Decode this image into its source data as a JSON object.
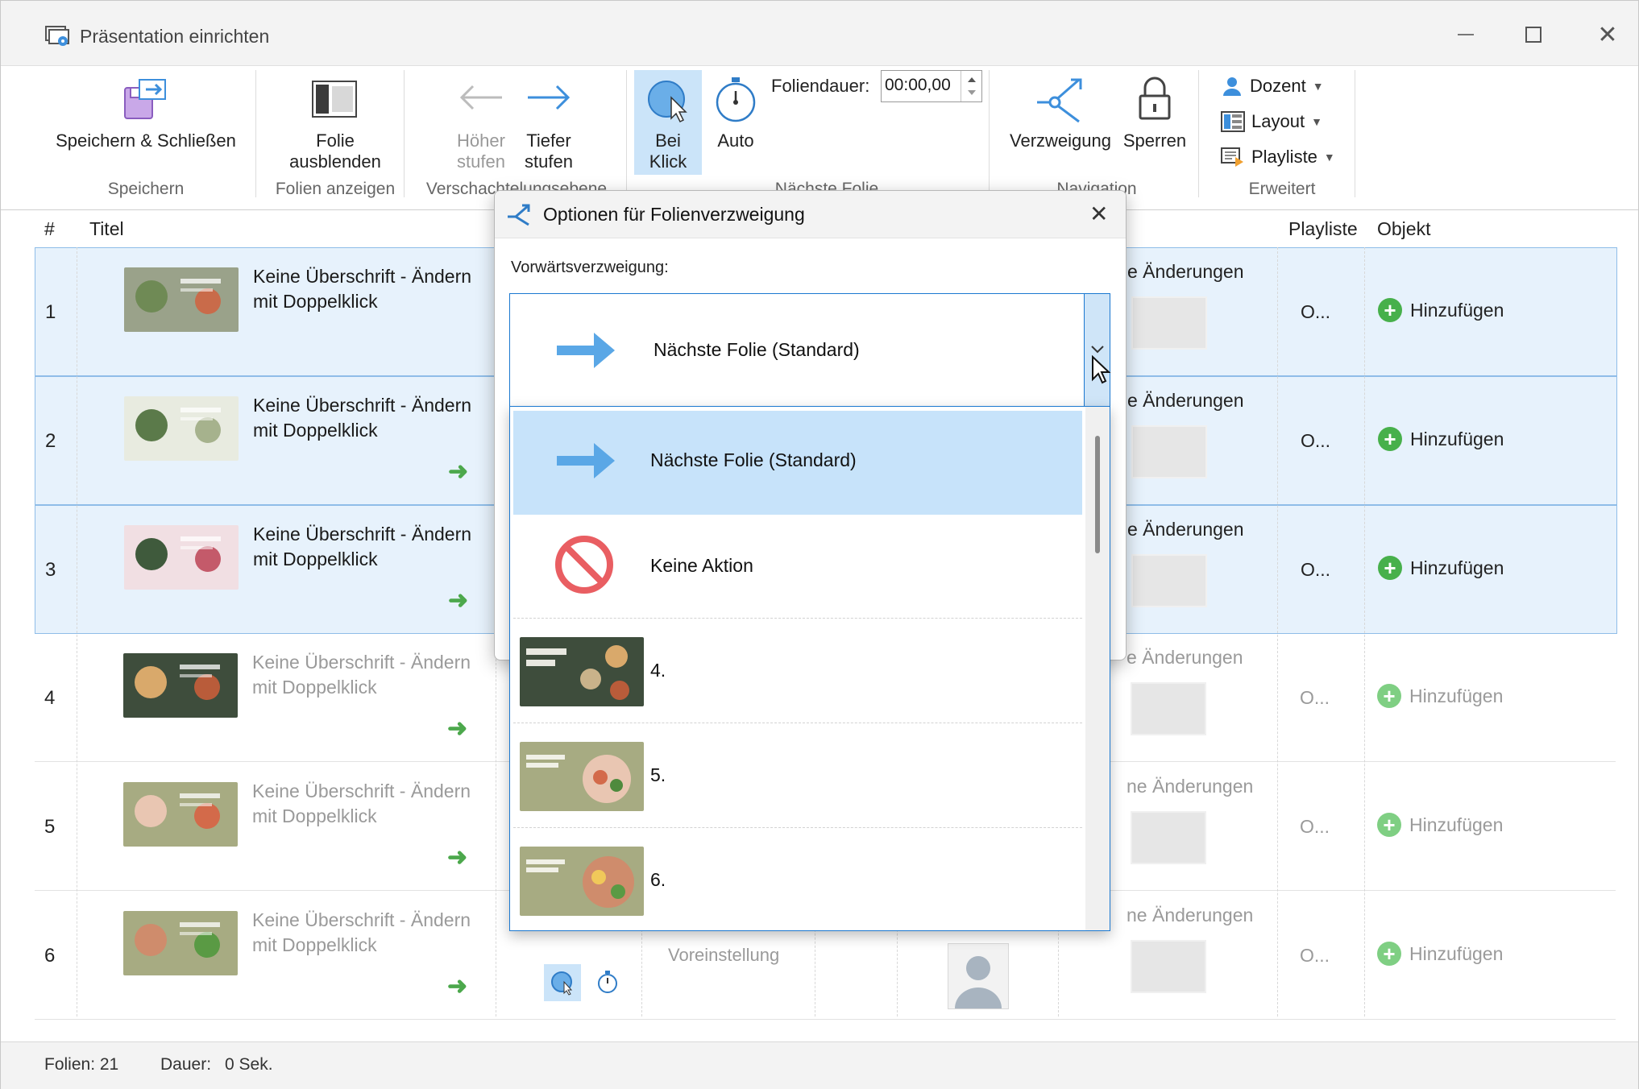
{
  "window": {
    "title": "Präsentation einrichten"
  },
  "ribbon": {
    "save_close_label": "Speichern & Schließen",
    "group_save": "Speichern",
    "hide_slide_label_1": "Folie",
    "hide_slide_label_2": "ausblenden",
    "group_show_slides": "Folien anzeigen",
    "promote_label_1": "Höher",
    "promote_label_2": "stufen",
    "demote_label_1": "Tiefer",
    "demote_label_2": "stufen",
    "group_nesting": "Verschachtelungsebene",
    "on_click_label_1": "Bei",
    "on_click_label_2": "Klick",
    "auto_label": "Auto",
    "slide_duration_label": "Foliendauer:",
    "slide_duration_value": "00:00,00",
    "group_next_slide": "Nächste Folie",
    "branching_label": "Verzweigung",
    "lock_label": "Sperren",
    "group_navigation": "Navigation",
    "presenter_label": "Dozent",
    "layout_label": "Layout",
    "playlist_label": "Playliste",
    "group_advanced": "Erweitert"
  },
  "table": {
    "col_number": "#",
    "col_title": "Titel",
    "col_playlist": "Playliste",
    "col_object": "Objekt",
    "rows": [
      {
        "num": "1",
        "title_1": "Keine Überschrift - Ändern",
        "title_2": "mit Doppelklick",
        "changes": "e Änderungen",
        "playlist": "O...",
        "add": "Hinzufügen",
        "thumb_text": "Richtige Ernährung"
      },
      {
        "num": "2",
        "title_1": "Keine Überschrift - Ändern",
        "title_2": "mit Doppelklick",
        "changes": "e Änderungen",
        "playlist": "O...",
        "add": "Hinzufügen",
        "thumb_text": "Einführung"
      },
      {
        "num": "3",
        "title_1": "Keine Überschrift - Ändern",
        "title_2": "mit Doppelklick",
        "changes": "e Änderungen",
        "playlist": "O...",
        "add": "Hinzufügen",
        "thumb_text": "Richtlinien"
      },
      {
        "num": "4",
        "title_1": "Keine Überschrift - Ändern",
        "title_2": "mit Doppelklick",
        "changes": "e Änderungen",
        "playlist": "O...",
        "add": "Hinzufügen",
        "thumb_text": "Wahlen Sie Ihre Mahlzeit"
      },
      {
        "num": "5",
        "title_1": "Keine Überschrift - Ändern",
        "title_2": "mit Doppelklick",
        "changes": "ne Änderungen",
        "playlist": "O...",
        "add": "Hinzufügen",
        "thumb_text": "Ein perfekter Frühstücksteller"
      },
      {
        "num": "6",
        "title_1": "Keine Überschrift - Ändern",
        "title_2": "mit Doppelklick",
        "changes": "ne Änderungen",
        "playlist": "O...",
        "add": "Hinzufügen",
        "thumb_text": "Ein perfekter Mittagsteller"
      }
    ],
    "row6_default": "Voreinstellung"
  },
  "status": {
    "slides": "Folien: 21",
    "duration_label": "Dauer:",
    "duration_value": "0 Sek."
  },
  "dialog": {
    "title": "Optionen für Folienverzweigung",
    "forward_label": "Vorwärtsverzweigung:",
    "selected_value": "Nächste Folie (Standard)",
    "options": [
      {
        "label": "Nächste Folie (Standard)"
      },
      {
        "label": "Keine Aktion"
      },
      {
        "label": "4."
      },
      {
        "label": "5."
      },
      {
        "label": "6."
      }
    ]
  },
  "colors": {
    "accent": "#1b78d0",
    "selection": "#e7f2fc",
    "highlight": "#c7e3fa",
    "green": "#47b04b",
    "arrow_blue": "#5aa7e6",
    "no_action_red": "#e95e62"
  }
}
